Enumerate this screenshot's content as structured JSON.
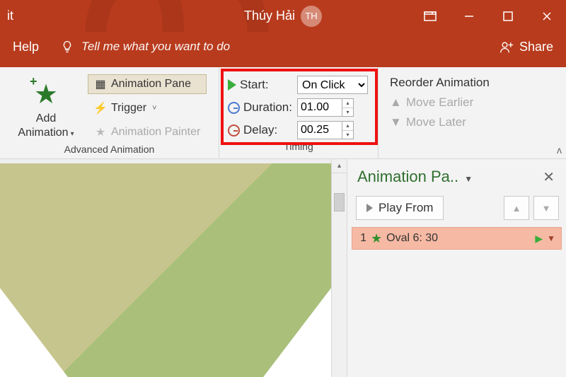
{
  "titlebar": {
    "left_fragment": "it",
    "doc_title": "Thúy Hải",
    "avatar_initials": "TH"
  },
  "subrow": {
    "help": "Help",
    "tellme": "Tell me what you want to do",
    "share": "Share"
  },
  "ribbon": {
    "add_animation": {
      "label_line1": "Add",
      "label_line2": "Animation"
    },
    "advanced": {
      "group_label": "Advanced Animation",
      "animation_pane": "Animation Pane",
      "trigger": "Trigger",
      "animation_painter": "Animation Painter"
    },
    "timing": {
      "group_label": "Timing",
      "start_label": "Start:",
      "start_value": "On Click",
      "duration_label": "Duration:",
      "duration_value": "01.00",
      "delay_label": "Delay:",
      "delay_value": "00.25"
    },
    "reorder": {
      "title": "Reorder Animation",
      "earlier": "Move Earlier",
      "later": "Move Later"
    }
  },
  "pane": {
    "title": "Animation Pa..",
    "play_label": "Play From",
    "item": {
      "index": "1",
      "name": "Oval 6: 30"
    }
  }
}
